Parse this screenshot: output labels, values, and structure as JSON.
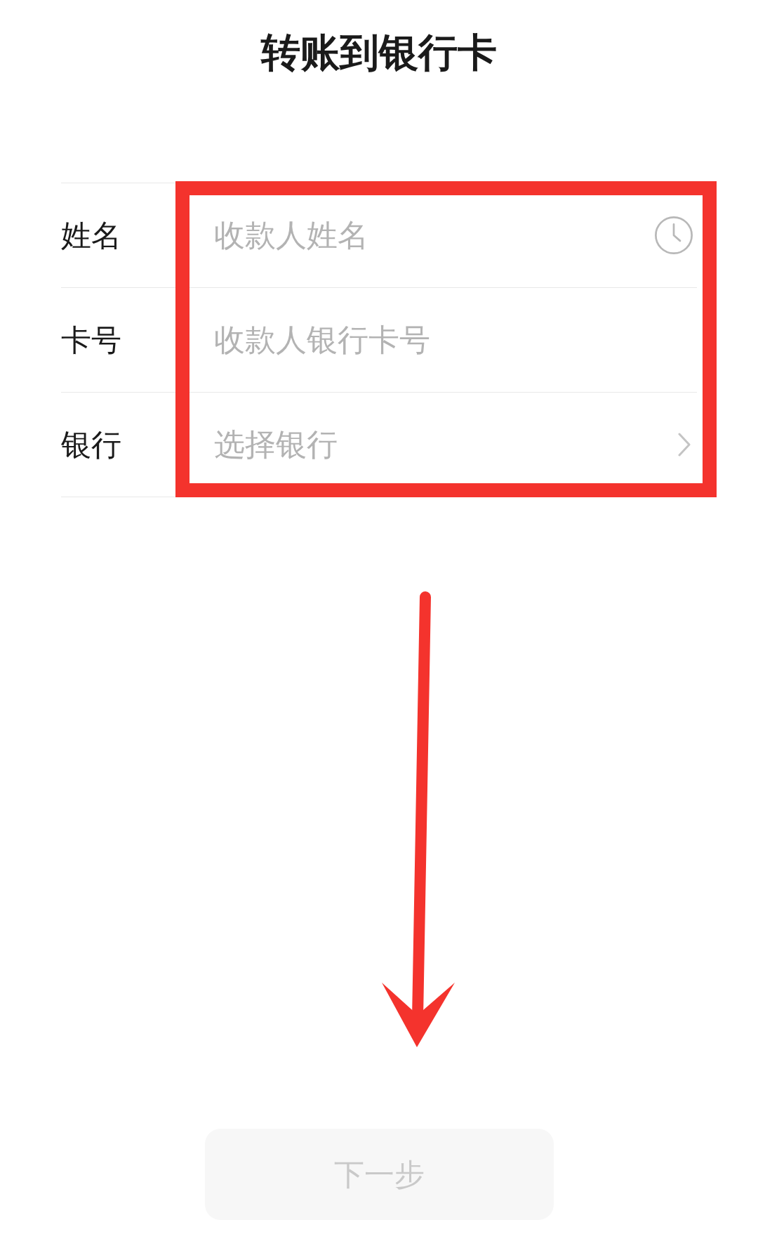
{
  "header": {
    "title": "转账到银行卡"
  },
  "form": {
    "fields": [
      {
        "label": "姓名",
        "placeholder": "收款人姓名",
        "kind": "history"
      },
      {
        "label": "卡号",
        "placeholder": "收款人银行卡号",
        "kind": "text"
      },
      {
        "label": "银行",
        "placeholder": "选择银行",
        "kind": "select"
      }
    ]
  },
  "next_button": {
    "label": "下一步",
    "disabled": true
  }
}
